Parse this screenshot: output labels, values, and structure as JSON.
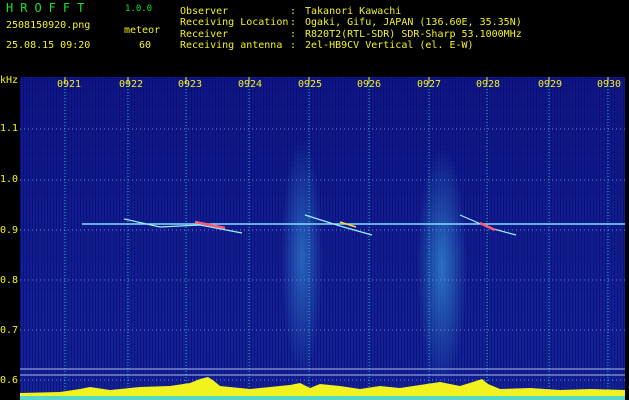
{
  "header": {
    "app_title": "HROFFT",
    "app_version": "1.0.0",
    "filename": "2508150920.png",
    "meteor_label": "meteor",
    "datetime": "25.08.15 09:20",
    "meteor_count": "60",
    "info": [
      {
        "key": "Observer",
        "sep": ":",
        "value": "Takanori Kawachi"
      },
      {
        "key": "Receiving Location",
        "sep": ":",
        "value": "Ogaki, Gifu, JAPAN (136.60E, 35.35N)"
      },
      {
        "key": "Receiver",
        "sep": ":",
        "value": "R820T2(RTL-SDR) SDR-Sharp 53.1000MHz"
      },
      {
        "key": "Receiving antenna",
        "sep": ":",
        "value": "2el-HB9CV Vertical (el. E-W)"
      }
    ]
  },
  "axis": {
    "unit": "kHz",
    "freq_ticks": [
      "1.1",
      "1.0",
      "0.9",
      "0.8",
      "0.7",
      "0.6"
    ],
    "time_ticks": [
      "0921",
      "0922",
      "0923",
      "0924",
      "0925",
      "0926",
      "0927",
      "0928",
      "0929",
      "0930"
    ]
  },
  "colors": {
    "label": "#f2f21e",
    "title": "#16e02a",
    "background": "#0f1990",
    "carrier": "#7fe0ff",
    "noise_floor": "#f2f21e"
  }
}
